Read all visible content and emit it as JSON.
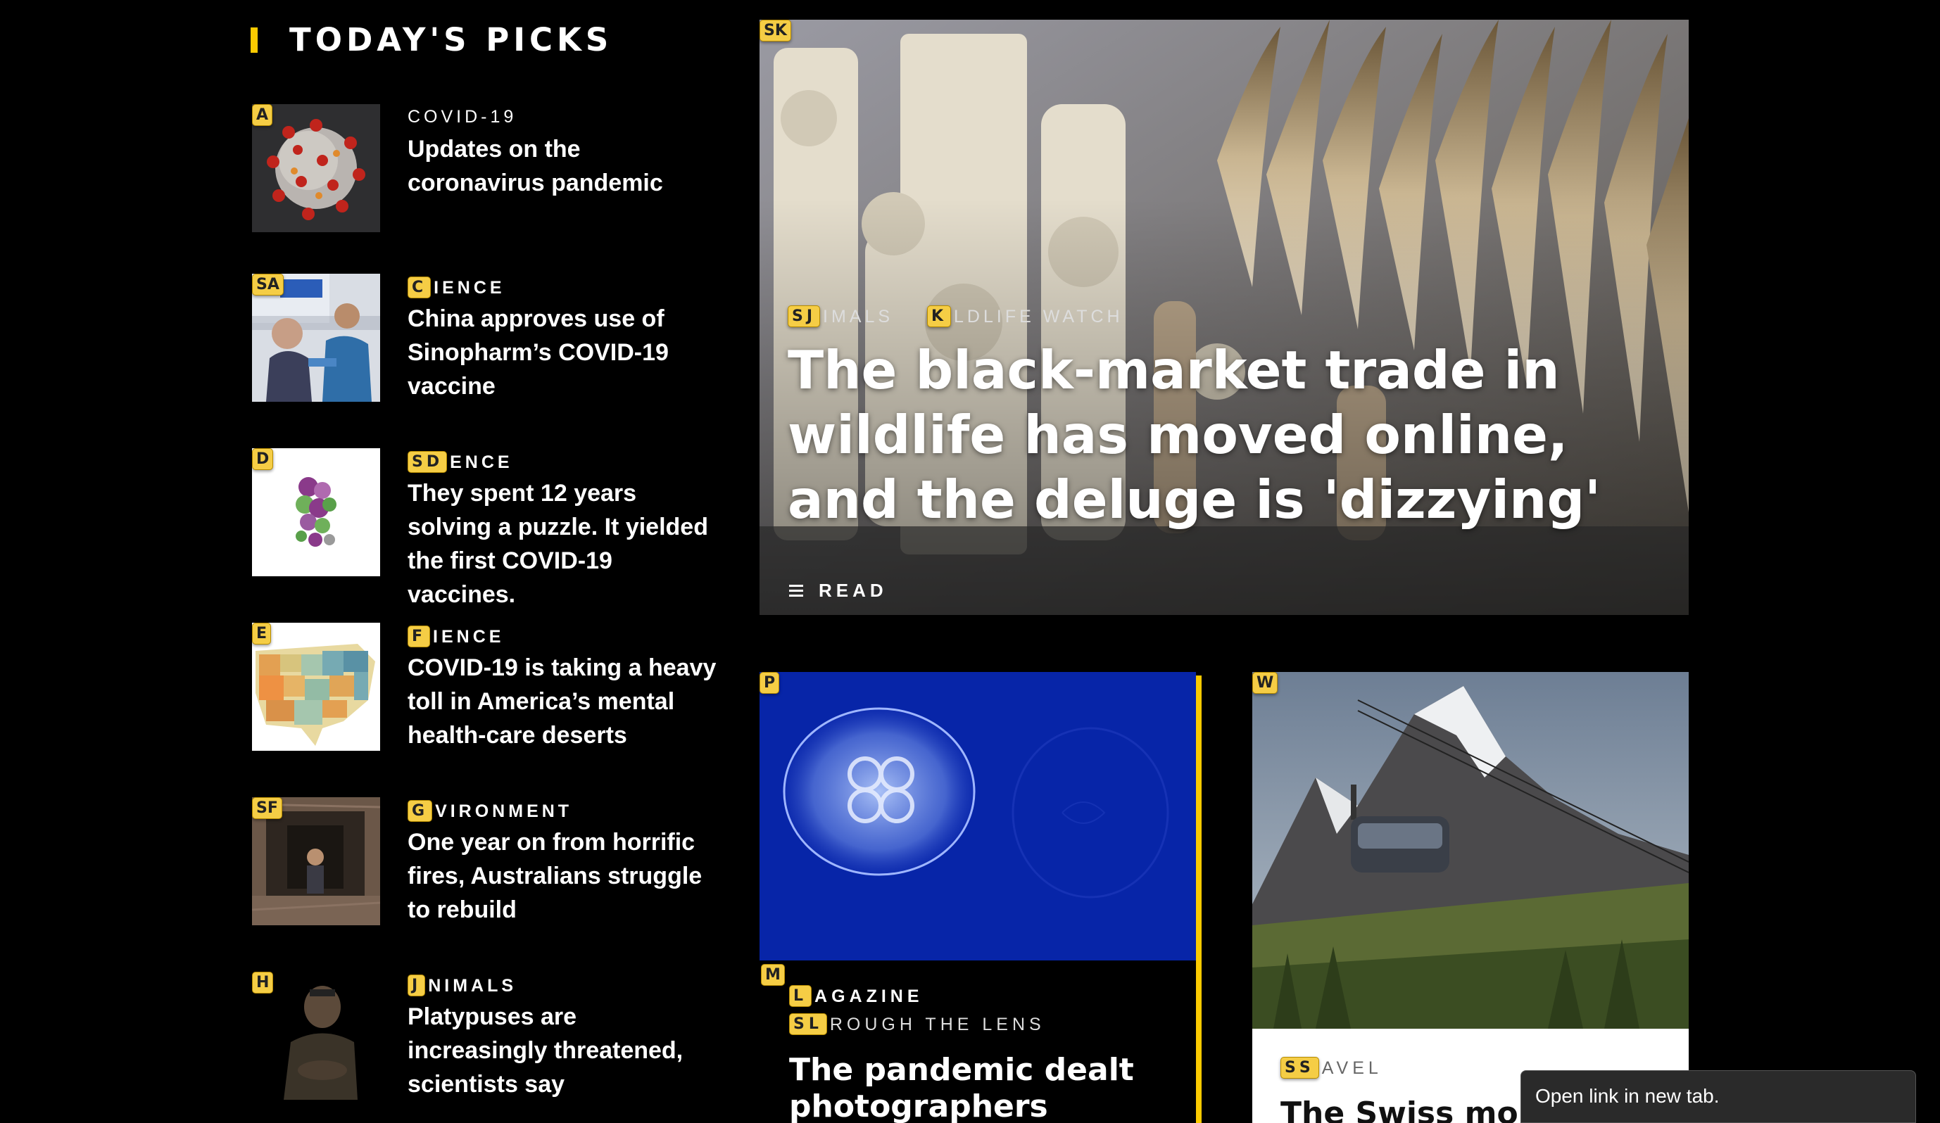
{
  "picks": {
    "title": "TODAY'S PICKS",
    "items": [
      {
        "hint": "A",
        "category": "COVID-19",
        "title": "Updates on the coronavirus pandemic"
      },
      {
        "hint": "SA",
        "cat_hint": "C",
        "category": "IENCE",
        "title": "China approves use of Sinopharm’s COVID-19 vaccine"
      },
      {
        "hint": "D",
        "cat_hint": "SD",
        "category": "ENCE",
        "title": "They spent 12 years solving a puzzle. It yielded the first COVID-19 vaccines."
      },
      {
        "hint": "E",
        "cat_hint": "F",
        "category": "IENCE",
        "title": "COVID-19 is taking a heavy toll in America’s mental health-care deserts"
      },
      {
        "hint": "SF",
        "cat_hint": "G",
        "category": "VIRONMENT",
        "title": "One year on from horrific fires, Australians struggle to rebuild"
      },
      {
        "hint": "H",
        "cat_hint": "J",
        "category": "NIMALS",
        "title": "Platypuses are increasingly threatened, scientists say"
      }
    ]
  },
  "hero": {
    "hint": "SK",
    "cat1_hint": "SJ",
    "cat1": "IMALS",
    "cat2_hint": "K",
    "cat2": "LDLIFE WATCH",
    "title": "The black-market trade in wildlife has moved online, and the deluge is 'dizzying'",
    "read": "READ"
  },
  "jelly_card": {
    "hint": "P",
    "hint2": "M",
    "cat1_hint": "L",
    "cat1": "AGAZINE",
    "cat2_hint": "SL",
    "cat2": "ROUGH THE LENS",
    "title": "The pandemic dealt photographers"
  },
  "swiss_card": {
    "hint": "W",
    "cat_hint": "SS",
    "category": "AVEL",
    "title": "The Swiss mount"
  },
  "tooltip": {
    "text": "Open link in new tab."
  },
  "colors": {
    "accent": "#fbca00",
    "hint_bg": "#f5cd45",
    "background": "#000000"
  }
}
